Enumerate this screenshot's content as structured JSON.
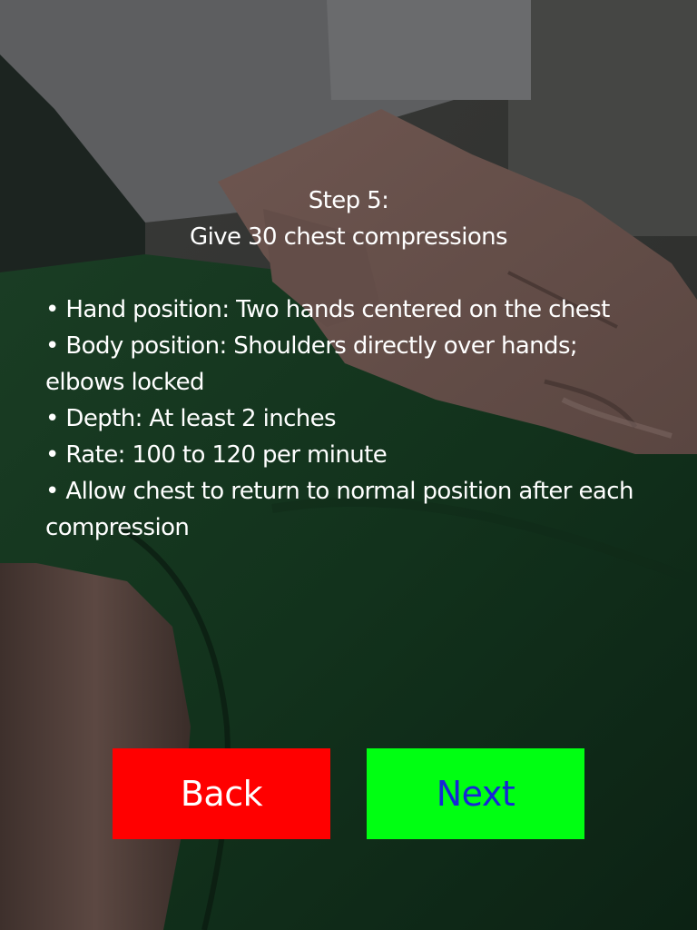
{
  "step": {
    "number_label": "Step 5:",
    "title": "Give 30 chest compressions"
  },
  "instructions": [
    "• Hand position: Two hands centered on the chest",
    "• Body position: Shoulders directly over hands; elbows locked",
    "• Depth: At least 2 inches",
    "• Rate: 100 to 120 per minute",
    "• Allow chest to return to normal position after each compression"
  ],
  "buttons": {
    "back_label": "Back",
    "next_label": "Next"
  },
  "colors": {
    "back_bg": "#ff0000",
    "back_text": "#ffffff",
    "next_bg": "#00ff12",
    "next_text": "#1626d6",
    "overlay_text": "#ffffff"
  }
}
